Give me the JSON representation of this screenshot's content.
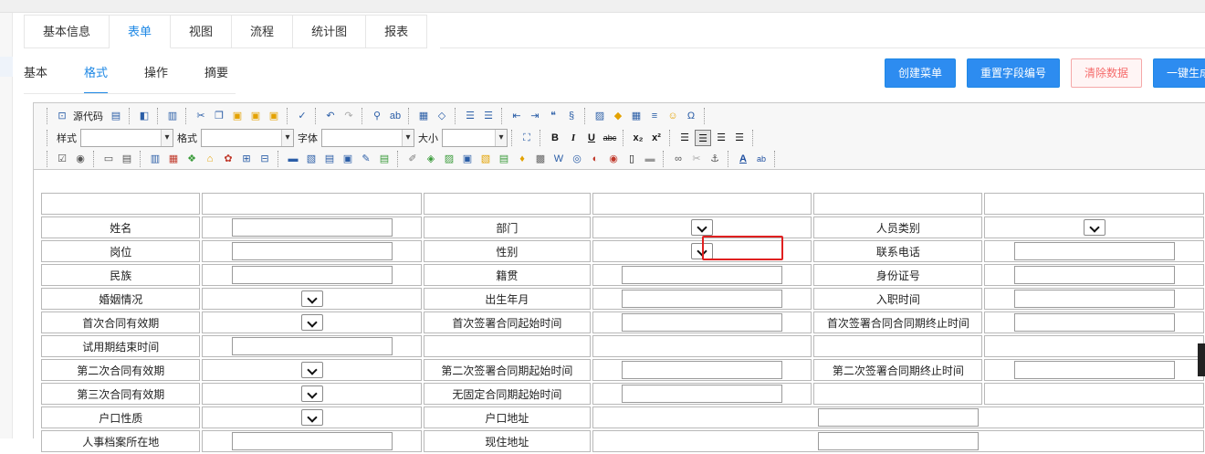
{
  "top_tabs": [
    "基本信息",
    "表单",
    "视图",
    "流程",
    "统计图",
    "报表"
  ],
  "sub_tabs": [
    "基本",
    "格式",
    "操作",
    "摘要"
  ],
  "buttons": {
    "create_menu": "创建菜单",
    "reset_field_no": "重置字段编号",
    "clear_data": "清除数据",
    "one_click": "一键生成"
  },
  "toolbar": {
    "source_label": "源代码",
    "style_label": "样式",
    "format_label": "格式",
    "font_label": "字体",
    "size_label": "大小",
    "bold": "B",
    "italic": "I",
    "underline": "U",
    "strike": "abc",
    "subscript": "x₂",
    "superscript": "x²",
    "omega": "Ω",
    "textcolor": "A",
    "bgcolor": "ab"
  },
  "form_rows": [
    [
      "",
      "",
      "",
      "",
      "",
      ""
    ],
    [
      "姓名",
      "",
      "部门",
      "",
      "人员类别",
      ""
    ],
    [
      "岗位",
      "",
      "性别",
      "",
      "联系电话",
      ""
    ],
    [
      "民族",
      "",
      "籍贯",
      "",
      "身份证号",
      ""
    ],
    [
      "婚姻情况",
      "",
      "出生年月",
      "",
      "入职时间",
      ""
    ],
    [
      "首次合同有效期",
      "",
      "首次签署合同起始时间",
      "",
      "首次签署合同合同期终止时间",
      ""
    ],
    [
      "试用期结束时间",
      "",
      "",
      "",
      "",
      ""
    ],
    [
      "第二次合同有效期",
      "",
      "第二次签署合同期起始时间",
      "",
      "第二次签署合同期终止时间",
      ""
    ],
    [
      "第三次合同有效期",
      "",
      "无固定合同期起始时间",
      "",
      "",
      ""
    ],
    [
      "户口性质",
      "",
      "户口地址",
      "",
      "",
      ""
    ],
    [
      "人事档案所在地",
      "",
      "现住地址",
      "",
      "",
      ""
    ]
  ],
  "colors": {
    "accent": "#1e88e5",
    "danger": "#f56c6c",
    "highlight": "#e02020"
  }
}
